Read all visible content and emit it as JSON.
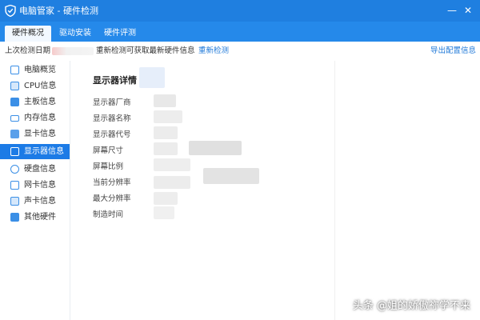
{
  "window": {
    "title": "电脑管家 - 硬件检测",
    "minimize_glyph": "—",
    "close_glyph": "✕"
  },
  "tabs": [
    {
      "label": "硬件概况",
      "active": true
    },
    {
      "label": "驱动安装",
      "active": false
    },
    {
      "label": "硬件评测",
      "active": false
    }
  ],
  "infobar": {
    "last_check_label": "上次检测日期",
    "hint": "重新检测可获取最新硬件信息",
    "recheck_link": "重新检测",
    "export_link": "导出配置信息"
  },
  "sidebar": {
    "items": [
      {
        "label": "电脑概览",
        "icon": "monitor-icon"
      },
      {
        "label": "CPU信息",
        "icon": "cpu-icon"
      },
      {
        "label": "主板信息",
        "icon": "motherboard-icon"
      },
      {
        "label": "内存信息",
        "icon": "memory-icon"
      },
      {
        "label": "显卡信息",
        "icon": "gpu-icon"
      },
      {
        "label": "显示器信息",
        "icon": "display-icon",
        "active": true
      },
      {
        "label": "硬盘信息",
        "icon": "disk-icon"
      },
      {
        "label": "网卡信息",
        "icon": "network-icon"
      },
      {
        "label": "声卡信息",
        "icon": "sound-icon"
      },
      {
        "label": "其他硬件",
        "icon": "other-hardware-icon"
      }
    ]
  },
  "main": {
    "section_title": "显示器详情",
    "fields": [
      {
        "label": "显示器厂商"
      },
      {
        "label": "显示器名称"
      },
      {
        "label": "显示器代号"
      },
      {
        "label": "屏幕尺寸"
      },
      {
        "label": "屏幕比例"
      },
      {
        "label": "当前分辨率"
      },
      {
        "label": "最大分辨率"
      },
      {
        "label": "制造时间"
      }
    ]
  },
  "watermark": "头条 @姐的娇傲祢学不来",
  "colors": {
    "titlebar": "#1f7fe0",
    "tabbar": "#2589ea",
    "accent": "#1c7be6",
    "link": "#1f79d8"
  }
}
